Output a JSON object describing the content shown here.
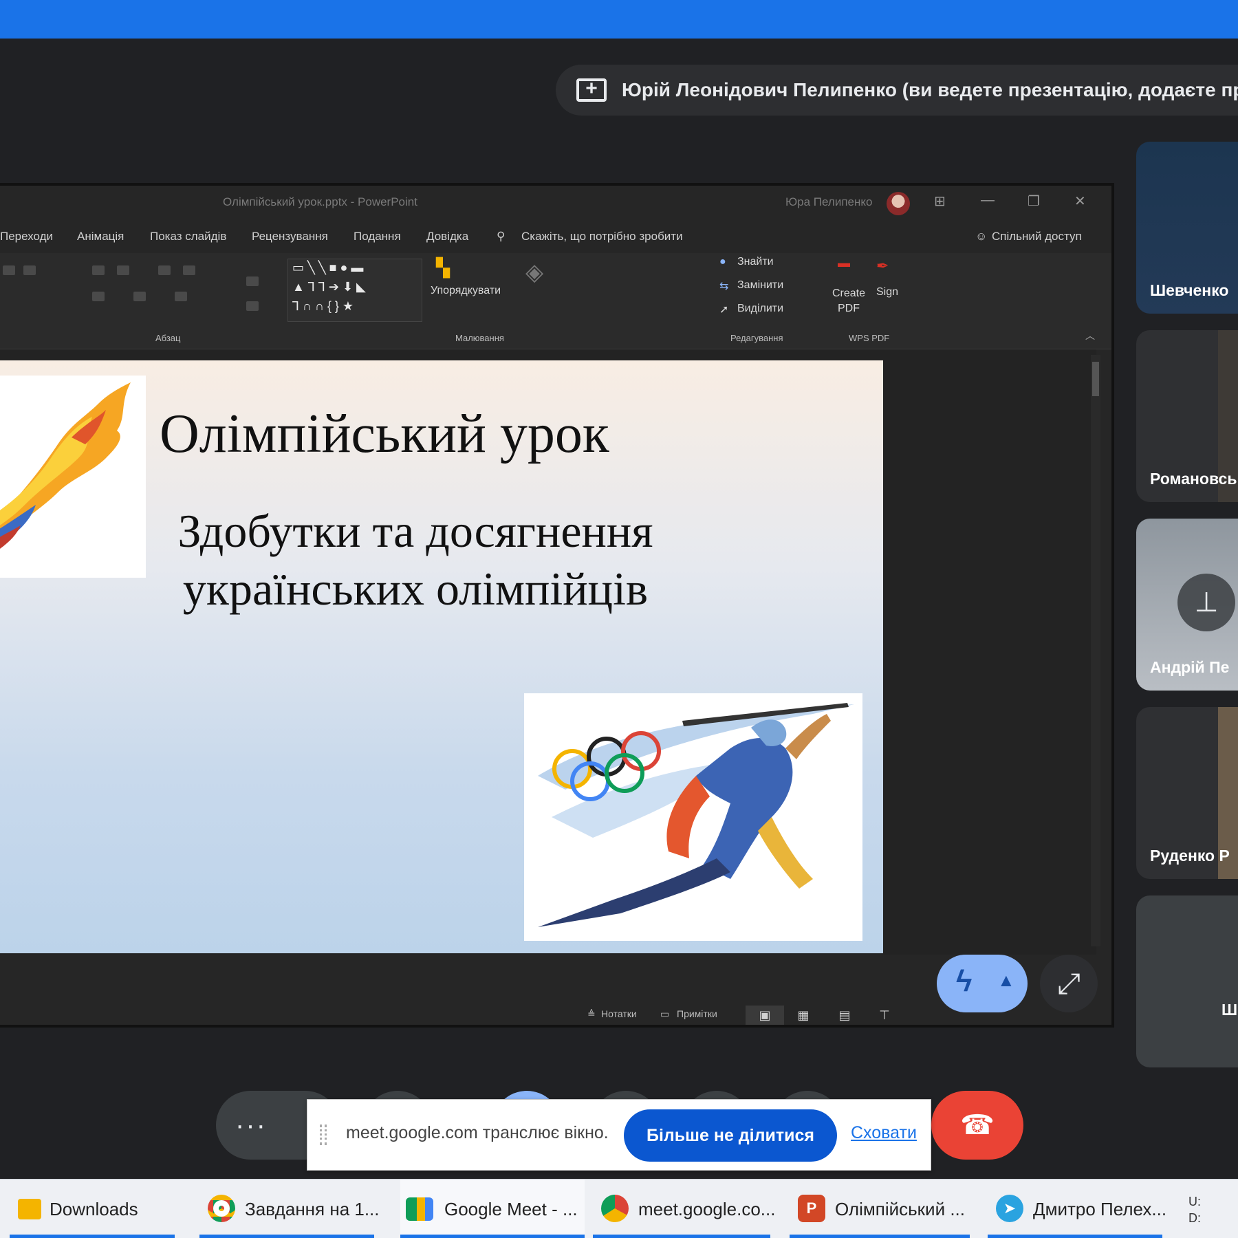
{
  "colors": {
    "meet_blue": "#1a73e8",
    "end_call_red": "#ea4335",
    "dark_bg": "#202124",
    "stop_share_blue": "#0b57d0"
  },
  "presenter_banner": {
    "icon": "present-screen-icon",
    "text": "Юрій Леонідович Пелипенко (ви ведете презентацію, додаєте пр"
  },
  "ppt": {
    "title": "Олімпійський урок.pptx - PowerPoint",
    "user": "Юра Пелипенко",
    "tabs": [
      "Переходи",
      "Анімація",
      "Показ слайдів",
      "Рецензування",
      "Подання",
      "Довідка",
      "Скажіть, що потрібно зробити"
    ],
    "share_label": "Спільний доступ",
    "ribbon": {
      "arrange": "Упорядкувати",
      "find": "Знайти",
      "replace": "Замінити",
      "select": "Виділити",
      "create_pdf": "Create PDF",
      "sign": "Sign",
      "groups": [
        "Абзац",
        "Малювання",
        "Редагування",
        "WPS PDF"
      ]
    },
    "slide": {
      "title": "Олімпійський урок",
      "subtitle": "Здобутки та досягнення українських олімпійців"
    },
    "status": {
      "notes": "Нотатки",
      "comments": "Примітки"
    }
  },
  "participants": [
    {
      "name": "Шевченко"
    },
    {
      "name": "Романовсь"
    },
    {
      "name": "Андрій Пе"
    },
    {
      "name": "Руденко Р"
    },
    {
      "name": "Ш"
    }
  ],
  "share_bar": {
    "message": "meet.google.com транслює вікно.",
    "stop_button": "Більше не ділитися",
    "hide_link": "Сховати"
  },
  "taskbar": [
    {
      "label": "Downloads",
      "icon": "folder-icon"
    },
    {
      "label": "Завдання на 1...",
      "icon": "chrome-icon"
    },
    {
      "label": "Google Meet - ...",
      "icon": "google-meet-icon"
    },
    {
      "label": "meet.google.co...",
      "icon": "chrome-icon"
    },
    {
      "label": "Олімпійський ...",
      "icon": "powerpoint-icon"
    },
    {
      "label": "Дмитро Пелех...",
      "icon": "telegram-icon"
    }
  ],
  "tray": [
    "U:",
    "D:"
  ]
}
